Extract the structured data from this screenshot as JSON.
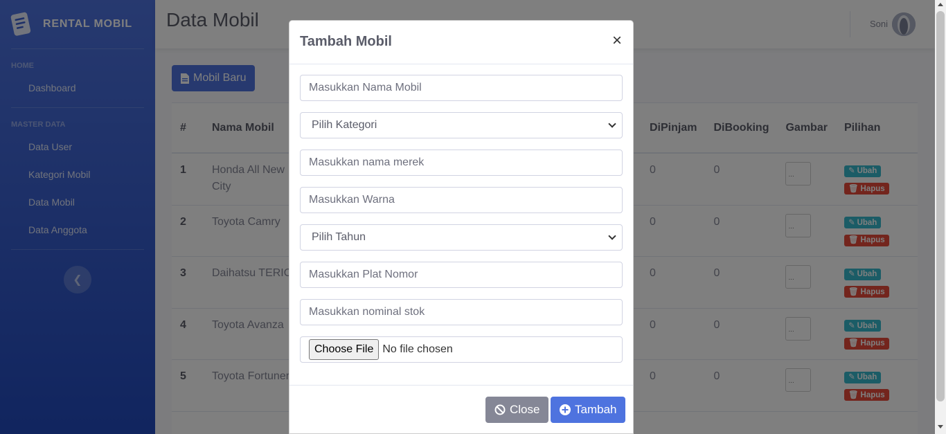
{
  "brand": {
    "name": "RENTAL MOBIL"
  },
  "sidebar": {
    "heading_home": "HOME",
    "dashboard": "Dashboard",
    "heading_master": "MASTER DATA",
    "items": [
      "Data User",
      "Kategori Mobil",
      "Data Mobil",
      "Data Anggota"
    ]
  },
  "topbar": {
    "page_title": "Data Mobil",
    "user_name": "Soni"
  },
  "content": {
    "new_button": "Mobil Baru"
  },
  "table": {
    "headers": [
      "#",
      "Nama Mobil",
      "DiPinjam",
      "DiBooking",
      "Gambar",
      "Pilihan"
    ],
    "rows": [
      {
        "no": "1",
        "name": "Honda All New City",
        "dipinjam": "0",
        "dibooking": "0",
        "img_alt": "..."
      },
      {
        "no": "2",
        "name": "Toyota Camry",
        "dipinjam": "0",
        "dibooking": "0",
        "img_alt": "..."
      },
      {
        "no": "3",
        "name": "Daihatsu TERIOS",
        "dipinjam": "0",
        "dibooking": "0",
        "img_alt": "..."
      },
      {
        "no": "4",
        "name": "Toyota Avanza",
        "dipinjam": "0",
        "dibooking": "0",
        "img_alt": "..."
      },
      {
        "no": "5",
        "name": "Toyota Fortuner",
        "dipinjam": "0",
        "dibooking": "0",
        "img_alt": "..."
      }
    ],
    "edit_label": "Ubah",
    "delete_label": "Hapus"
  },
  "modal": {
    "title": "Tambah Mobil",
    "close_symbol": "×",
    "fields": {
      "nama_mobil_placeholder": "Masukkan Nama Mobil",
      "kategori_selected": "Pilih Kategori",
      "merek_placeholder": "Masukkan nama merek",
      "warna_placeholder": "Masukkan Warna",
      "tahun_selected": "Pilih Tahun",
      "plat_placeholder": "Masukkan Plat Nomor",
      "stok_placeholder": "Masukkan nominal stok",
      "file_button": "Choose File",
      "file_status": "No file chosen"
    },
    "close_button": "Close",
    "add_button": "Tambah"
  },
  "colors": {
    "primary": "#4e73df",
    "info": "#36b9cc",
    "danger": "#e74a3b",
    "secondary": "#858796"
  }
}
